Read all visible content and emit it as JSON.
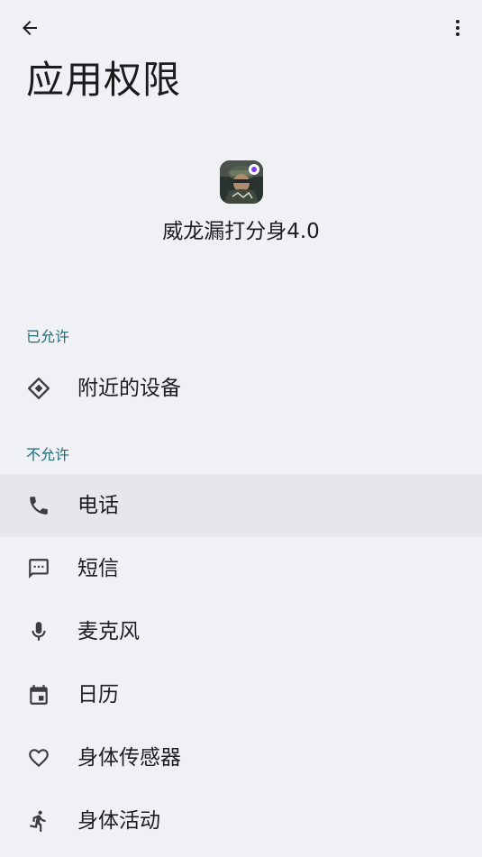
{
  "page": {
    "title": "应用权限"
  },
  "app": {
    "name": "威龙漏打分身4.0"
  },
  "sections": {
    "allowed": {
      "label": "已允许",
      "items": [
        {
          "label": "附近的设备",
          "icon": "nearby-devices-icon"
        }
      ]
    },
    "denied": {
      "label": "不允许",
      "items": [
        {
          "label": "电话",
          "icon": "phone-icon"
        },
        {
          "label": "短信",
          "icon": "sms-icon"
        },
        {
          "label": "麦克风",
          "icon": "microphone-icon"
        },
        {
          "label": "日历",
          "icon": "calendar-icon"
        },
        {
          "label": "身体传感器",
          "icon": "heart-icon"
        },
        {
          "label": "身体活动",
          "icon": "walking-icon"
        }
      ]
    }
  },
  "colors": {
    "background": "#eff1f4",
    "section_label": "#1f6b78",
    "highlight_row": "#e5e7ea",
    "icon": "#3a3d42"
  }
}
